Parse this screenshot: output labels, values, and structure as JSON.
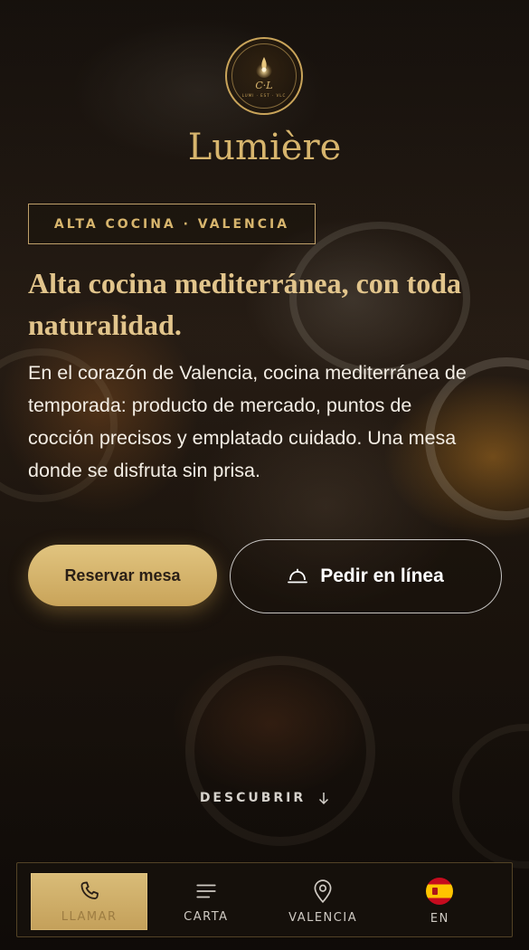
{
  "brand": {
    "logo_monogram": "C·L",
    "logo_est": "LUMI · EST · VLC",
    "name": "Lumière"
  },
  "hero": {
    "tag": "ALTA COCINA · VALENCIA",
    "headline": "Alta cocina mediterránea, con toda naturalidad.",
    "lead": "En el corazón de Valencia, cocina mediterránea de temporada: producto de mercado, puntos de cocción precisos y emplatado cuidado. Una mesa donde se disfruta sin prisa."
  },
  "actions": {
    "reserve_label": "Reservar mesa",
    "order_label": "Pedir en línea",
    "order_icon": "cloche-icon"
  },
  "discover": {
    "label": "DESCUBRIR",
    "icon": "arrow-down-icon"
  },
  "bottom_nav": {
    "items": [
      {
        "label": "LLAMAR",
        "icon": "phone-icon",
        "active": true
      },
      {
        "label": "CARTA",
        "icon": "menu-lines-icon",
        "active": false
      },
      {
        "label": "VALENCIA",
        "icon": "map-pin-icon",
        "active": false
      },
      {
        "label": "EN",
        "icon": "spain-flag-icon",
        "active": false
      }
    ]
  },
  "colors": {
    "accent_gold": "#c9a45a",
    "gold_light": "#e1c47f",
    "background": "#17110c",
    "text_light": "#f3ede4"
  }
}
